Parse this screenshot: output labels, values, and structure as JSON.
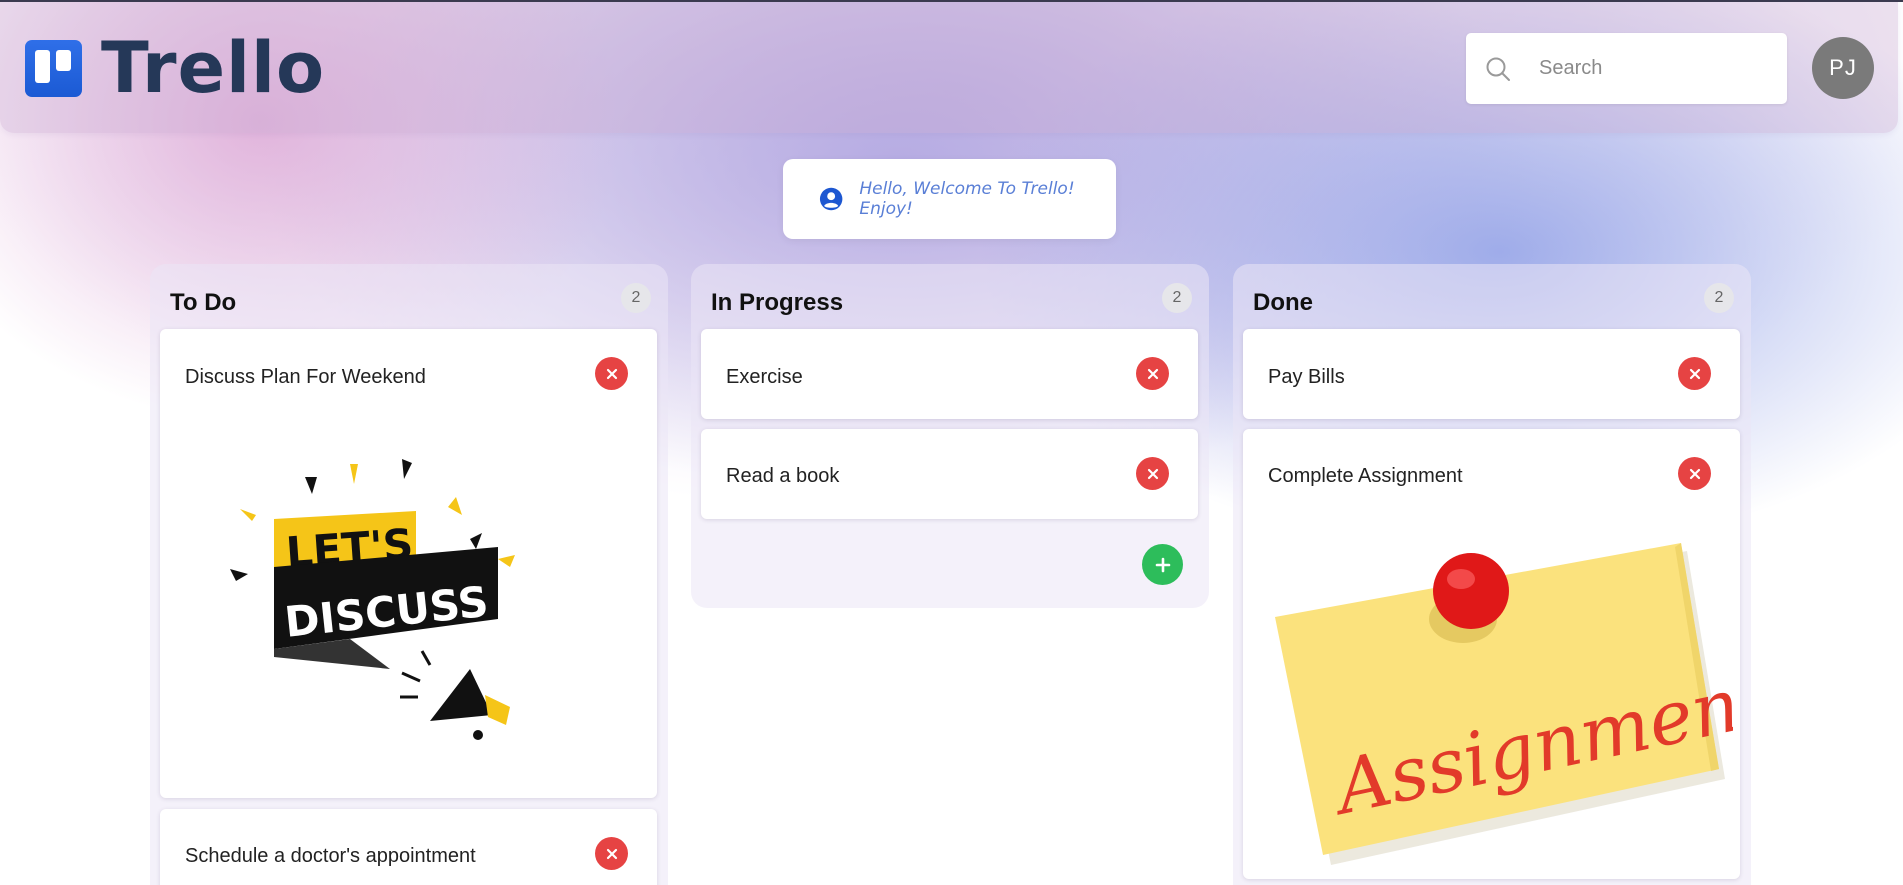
{
  "header": {
    "logo_text": "Trello",
    "search": {
      "placeholder": "Search",
      "value": ""
    },
    "avatar_initials": "PJ"
  },
  "welcome": {
    "message": "Hello, Welcome To Trello! Enjoy!"
  },
  "columns": [
    {
      "title": "To Do",
      "count": "2",
      "cards": [
        {
          "title": "Discuss Plan For Weekend",
          "image": "lets-discuss-image",
          "image_text": [
            "LET'S",
            "DISCUSS"
          ]
        },
        {
          "title": "Schedule a doctor's appointment"
        }
      ]
    },
    {
      "title": "In Progress",
      "count": "2",
      "cards": [
        {
          "title": "Exercise"
        },
        {
          "title": "Read a book"
        }
      ]
    },
    {
      "title": "Done",
      "count": "2",
      "cards": [
        {
          "title": "Pay Bills"
        },
        {
          "title": "Complete Assignment",
          "image": "assignment-sticky-note-image",
          "image_text": [
            "Assignment"
          ]
        }
      ]
    }
  ],
  "colors": {
    "delete_button": "#e64343",
    "add_button": "#2dbd5b",
    "brand_blue": "#1b5ad4",
    "logo_text": "#253858",
    "welcome_text": "#5a7fd6"
  },
  "icons": {
    "search": "search-icon",
    "user": "user-circle-icon",
    "delete": "close-icon",
    "add": "plus-icon"
  }
}
